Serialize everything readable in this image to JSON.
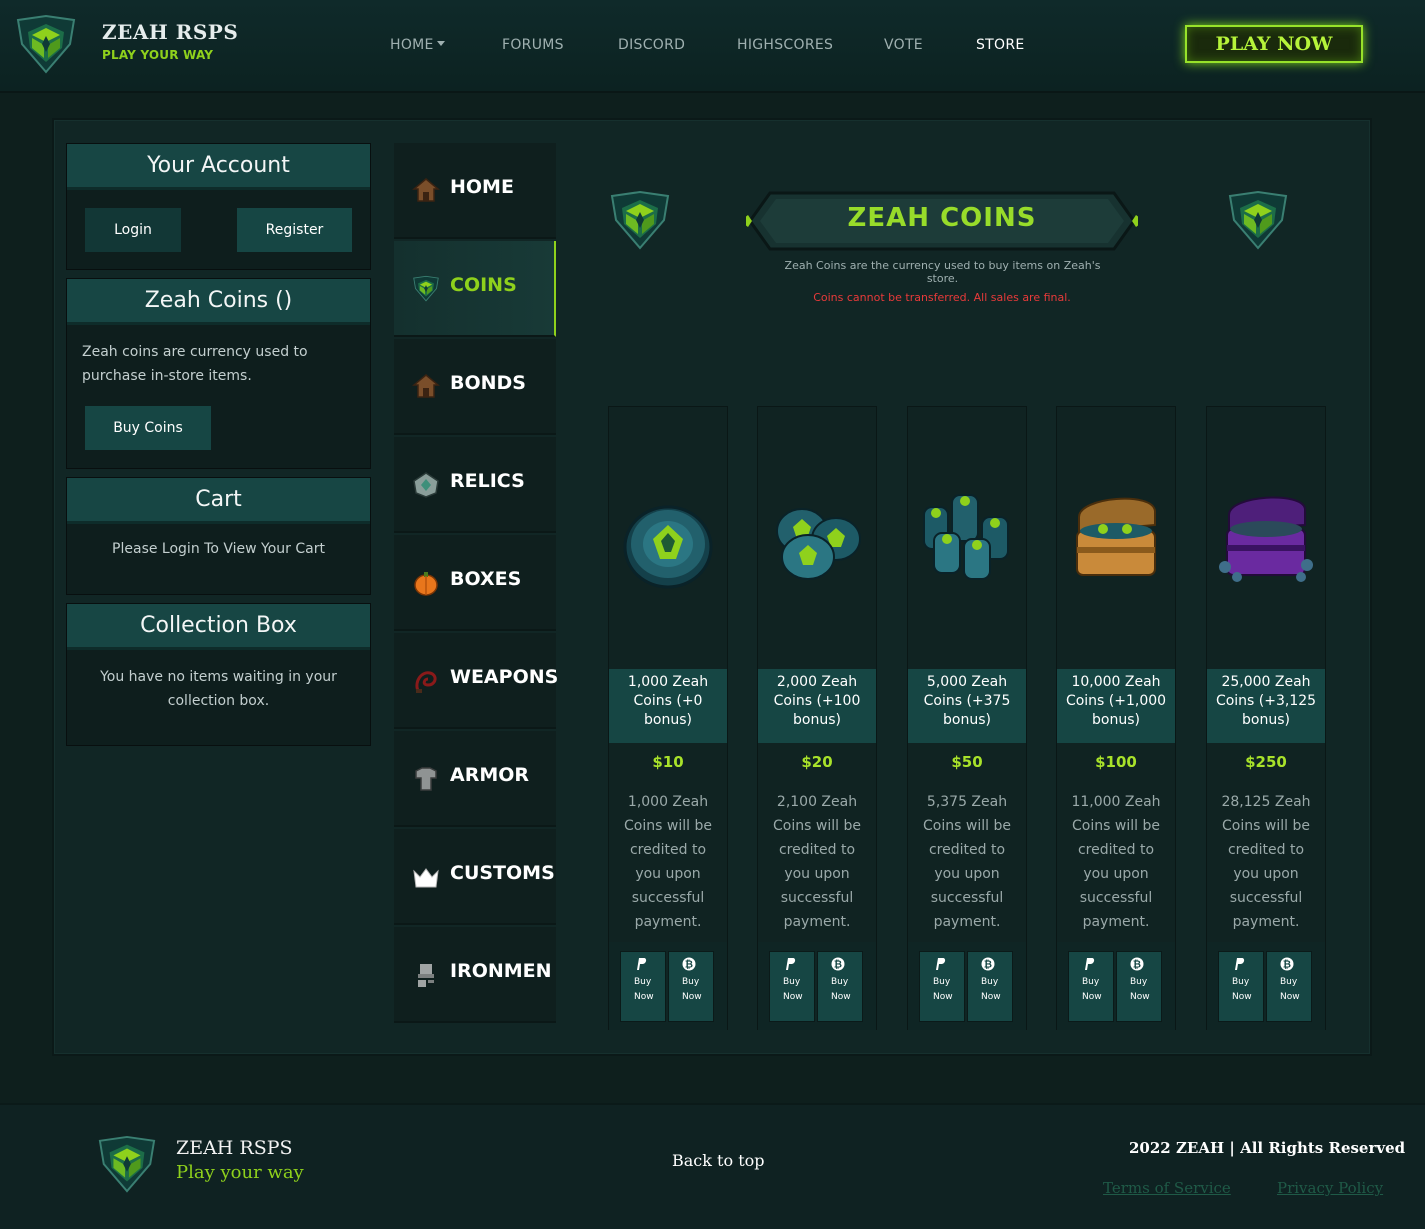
{
  "header": {
    "brand_title": "ZEAH RSPS",
    "brand_subtitle": "PLAY YOUR WAY",
    "nav": [
      "HOME",
      "FORUMS",
      "DISCORD",
      "HIGHSCORES",
      "VOTE",
      "STORE"
    ],
    "active_nav": "STORE",
    "play_now": "PLAY NOW"
  },
  "sidebar": {
    "account": {
      "title": "Your Account",
      "login": "Login",
      "register": "Register"
    },
    "coins": {
      "title": "Zeah Coins ()",
      "text": "Zeah coins are currency used to purchase in-store items.",
      "buy": "Buy Coins"
    },
    "cart": {
      "title": "Cart",
      "text": "Please Login To View Your Cart"
    },
    "collection": {
      "title": "Collection Box",
      "text": "You have no items waiting in your collection box."
    }
  },
  "categories": [
    {
      "label": "HOME",
      "icon": "house-icon",
      "active": false
    },
    {
      "label": "COINS",
      "icon": "zeah-logo-icon",
      "active": true
    },
    {
      "label": "BONDS",
      "icon": "house-icon",
      "active": false
    },
    {
      "label": "RELICS",
      "icon": "relic-icon",
      "active": false
    },
    {
      "label": "BOXES",
      "icon": "pumpkin-icon",
      "active": false
    },
    {
      "label": "WEAPONS",
      "icon": "whip-icon",
      "active": false
    },
    {
      "label": "ARMOR",
      "icon": "platebody-icon",
      "active": false
    },
    {
      "label": "CUSTOMS",
      "icon": "crown-icon",
      "active": false
    },
    {
      "label": "IRONMEN",
      "icon": "iron-helm-icon",
      "active": false
    }
  ],
  "store": {
    "banner_title": "ZEAH COINS",
    "description": "Zeah Coins are the currency used to buy items on Zeah's store.",
    "warning": "Coins cannot be transferred. All sales are final.",
    "buy_line1": "Buy",
    "buy_line2": "Now",
    "products": [
      {
        "name": "1,000 Zeah Coins (+0 bonus)",
        "price": "$10",
        "desc": "1,000 Zeah Coins will be credited to you upon successful payment.",
        "icon": "single-coin-icon"
      },
      {
        "name": "2,000 Zeah Coins (+100 bonus)",
        "price": "$20",
        "desc": "2,100 Zeah Coins will be credited to you upon successful payment.",
        "icon": "coin-stack-icon"
      },
      {
        "name": "5,000 Zeah Coins (+375 bonus)",
        "price": "$50",
        "desc": "5,375 Zeah Coins will be credited to you upon successful payment.",
        "icon": "coin-pile-icon"
      },
      {
        "name": "10,000 Zeah Coins (+1,000 bonus)",
        "price": "$100",
        "desc": "11,000 Zeah Coins will be credited to you upon successful payment.",
        "icon": "treasure-chest-icon"
      },
      {
        "name": "25,000 Zeah Coins (+3,125 bonus)",
        "price": "$250",
        "desc": "28,125 Zeah Coins will be credited to you upon successful payment.",
        "icon": "purple-chest-icon"
      }
    ]
  },
  "footer": {
    "title": "ZEAH RSPS",
    "subtitle": "Play your way",
    "back_to_top": "Back to top",
    "rights": "2022 ZEAH | All Rights Reserved",
    "terms": "Terms of Service",
    "privacy": "Privacy Policy"
  },
  "colors": {
    "accent": "#8fd11c",
    "teal": "#164644",
    "warning": "#e83a3a",
    "background": "#0e1f1d"
  }
}
